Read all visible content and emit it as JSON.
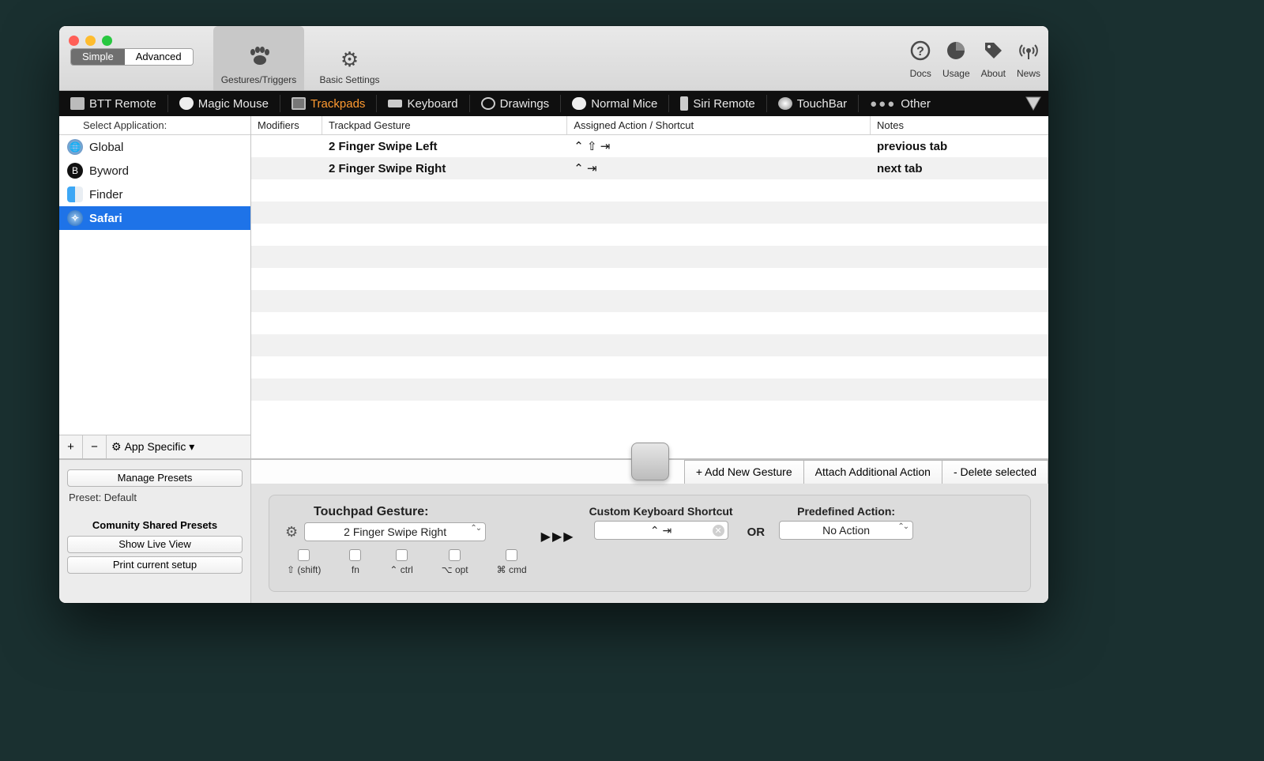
{
  "segmented": {
    "simple": "Simple",
    "advanced": "Advanced"
  },
  "toolbar_tabs": {
    "gestures": "Gestures/Triggers",
    "settings": "Basic Settings"
  },
  "right_icons": {
    "docs": "Docs",
    "usage": "Usage",
    "about": "About",
    "news": "News"
  },
  "device_tabs": [
    "BTT Remote",
    "Magic Mouse",
    "Trackpads",
    "Keyboard",
    "Drawings",
    "Normal Mice",
    "Siri Remote",
    "TouchBar",
    "Other"
  ],
  "device_active_index": 2,
  "sidebar": {
    "header": "Select Application:",
    "apps": [
      "Global",
      "Byword",
      "Finder",
      "Safari"
    ],
    "selected_index": 3,
    "add_icon": "+",
    "remove_icon": "−",
    "gear_icon": "⚙",
    "app_specific": "App Specific ▾"
  },
  "table": {
    "headers": {
      "mod": "Modifiers",
      "gesture": "Trackpad Gesture",
      "action": "Assigned Action / Shortcut",
      "notes": "Notes"
    },
    "rows": [
      {
        "gesture": "2 Finger Swipe Left",
        "action": "⌃ ⇧  ⇥",
        "note": "previous tab"
      },
      {
        "gesture": "2 Finger Swipe Right",
        "action": "⌃  ⇥",
        "note": "next tab"
      }
    ]
  },
  "action_buttons": {
    "add": "+ Add New Gesture",
    "attach": "Attach Additional Action",
    "delete": "- Delete selected"
  },
  "bottom_left": {
    "manage": "Manage Presets",
    "preset_label": "Preset: Default",
    "community_title": "Comunity Shared Presets",
    "show_live": "Show Live View",
    "print_setup": "Print current setup"
  },
  "config": {
    "gesture_title": "Touchpad Gesture:",
    "gesture_value": "2 Finger Swipe Right",
    "mods": [
      "⇧ (shift)",
      "fn",
      "⌃ ctrl",
      "⌥ opt",
      "⌘ cmd"
    ],
    "arrows": "▶▶▶",
    "shortcut_title": "Custom Keyboard Shortcut",
    "shortcut_value": "⌃  ⇥",
    "or": "OR",
    "action_title": "Predefined Action:",
    "action_value": "No Action"
  }
}
